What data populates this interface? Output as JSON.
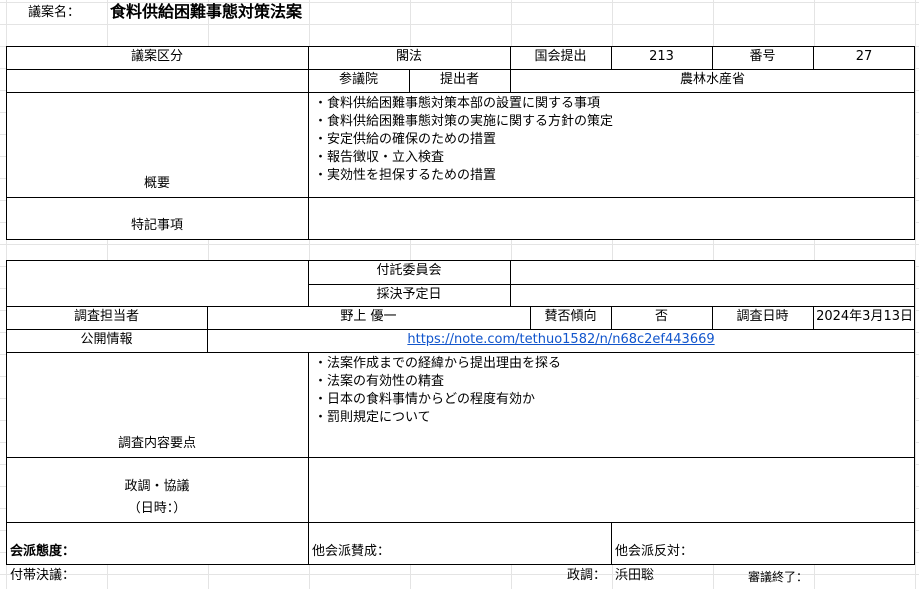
{
  "header": {
    "label": "議案名：",
    "title": "食料供給困難事態対策法案"
  },
  "row1": {
    "category_label": "議案区分",
    "category_value": "閣法",
    "submitted_label": "国会提出",
    "submitted_value": "213",
    "number_label": "番号",
    "number_value": "27"
  },
  "row2": {
    "house": "参議院",
    "submitter_label": "提出者",
    "submitter_value": "農林水産省"
  },
  "summary": {
    "label": "概要",
    "items": [
      "・食料供給困難事態対策本部の設置に関する事項",
      "・食料供給困難事態対策の実施に関する方針の策定",
      "・安定供給の確保のための措置",
      "・報告徴収・立入検査",
      "・実効性を担保するための措置"
    ]
  },
  "special": {
    "label": "特記事項",
    "value": ""
  },
  "committee": {
    "label": "付託委員会",
    "value": ""
  },
  "vote_date": {
    "label": "採決予定日",
    "value": ""
  },
  "research": {
    "person_label": "調査担当者",
    "person_value": "野上 優一",
    "stance_label": "賛否傾向",
    "stance_value": "否",
    "date_label": "調査日時",
    "date_value": "2024年3月13日"
  },
  "public": {
    "label": "公開情報",
    "url": "https://note.com/tethuo1582/n/n68c2ef443669"
  },
  "points": {
    "label": "調査内容要点",
    "items": [
      "・法案作成までの経緯から提出理由を探る",
      "・法案の有効性の精査",
      "・日本の食料事情からどの程度有効か",
      "・罰則規定について"
    ]
  },
  "policy": {
    "label": "政調・協議",
    "date": "（日時：）"
  },
  "factions": {
    "stance_label": "会派態度：",
    "others_for": "他会派賛成：",
    "others_against": "他会派反対："
  },
  "footer": {
    "resolution": "付帯決議：",
    "policy_label": "政調：",
    "policy_person": "浜田聡",
    "review_end": "審議終了："
  }
}
